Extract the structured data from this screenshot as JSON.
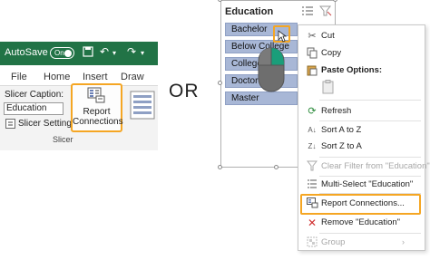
{
  "left_panel": {
    "autosave_label": "AutoSave",
    "autosave_state": "On",
    "tabs": [
      "File",
      "Home",
      "Insert",
      "Draw"
    ],
    "slicer_caption_label": "Slicer Caption:",
    "slicer_caption_value": "Education",
    "slicer_settings_label": "Slicer Settings",
    "group_label": "Slicer",
    "report_connections_label": [
      "Report",
      "Connections"
    ],
    "accent_color": "#217346",
    "highlight_color": "#f5a623"
  },
  "separator_text": "OR",
  "slicer": {
    "title": "Education",
    "items": [
      "Bachelor",
      "Below College",
      "College",
      "Doctor",
      "Master"
    ]
  },
  "context_menu": {
    "items": [
      {
        "label": "Cut",
        "icon": "scissors-icon",
        "enabled": true
      },
      {
        "label": "Copy",
        "icon": "copy-icon",
        "enabled": true
      },
      {
        "label": "Paste Options:",
        "icon": "paste-icon",
        "enabled": true
      },
      {
        "label": "Refresh",
        "icon": "refresh-icon",
        "enabled": true
      },
      {
        "label": "Sort A to Z",
        "icon": "sort-asc-icon",
        "enabled": true
      },
      {
        "label": "Sort Z to A",
        "icon": "sort-desc-icon",
        "enabled": true
      },
      {
        "label": "Clear Filter from \"Education\"",
        "icon": "clear-filter-icon",
        "enabled": false
      },
      {
        "label": "Multi-Select \"Education\"",
        "icon": "multiselect-icon",
        "enabled": true
      },
      {
        "label": "Report Connections...",
        "icon": "report-connections-icon",
        "enabled": true
      },
      {
        "label": "Remove \"Education\"",
        "icon": "remove-icon",
        "enabled": true
      },
      {
        "label": "Group",
        "icon": "group-icon",
        "enabled": false
      }
    ]
  }
}
